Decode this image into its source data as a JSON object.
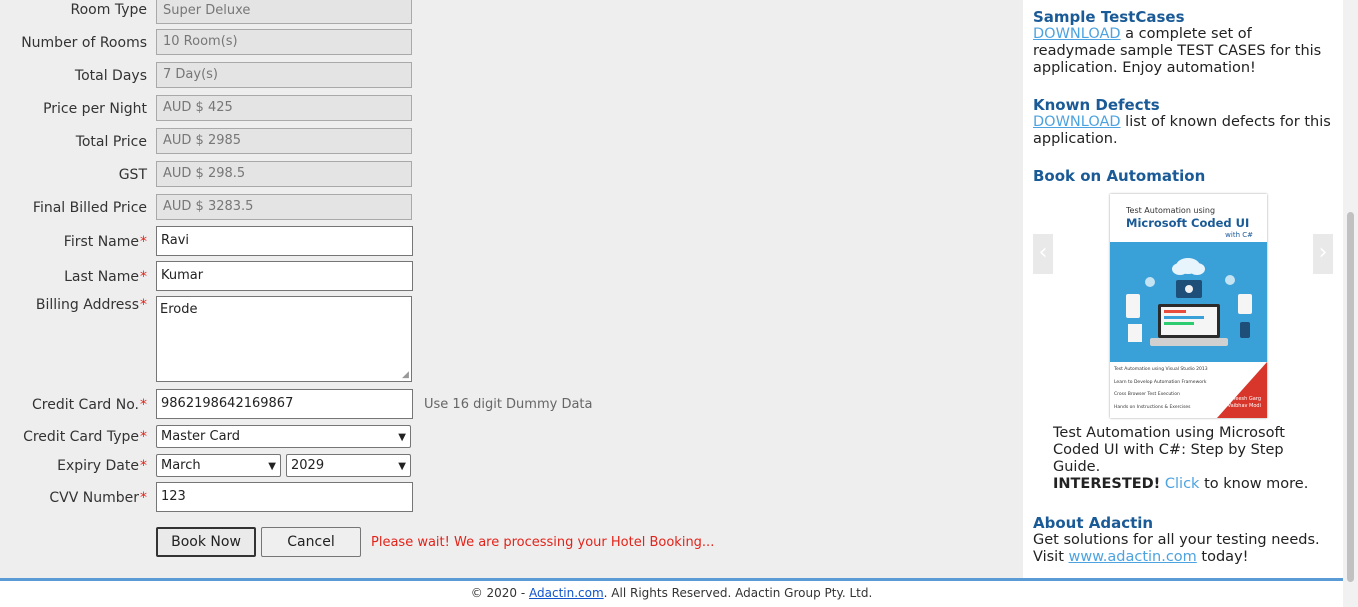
{
  "form": {
    "room_type": {
      "label": "Room Type",
      "value": "Super Deluxe"
    },
    "number_of_rooms": {
      "label": "Number of Rooms",
      "value": "10 Room(s)"
    },
    "total_days": {
      "label": "Total Days",
      "value": "7 Day(s)"
    },
    "price_per_night": {
      "label": "Price per Night",
      "value": "AUD $ 425"
    },
    "total_price": {
      "label": "Total Price",
      "value": "AUD $ 2985"
    },
    "gst": {
      "label": "GST",
      "value": "AUD $ 298.5"
    },
    "final_billed_price": {
      "label": "Final Billed Price",
      "value": "AUD $ 3283.5"
    },
    "first_name": {
      "label": "First Name",
      "value": "Ravi"
    },
    "last_name": {
      "label": "Last Name",
      "value": "Kumar"
    },
    "billing_address": {
      "label": "Billing Address",
      "value": "Erode"
    },
    "credit_card_no": {
      "label": "Credit Card No.",
      "value": "9862198642169867",
      "hint": "Use 16 digit Dummy Data"
    },
    "credit_card_type": {
      "label": "Credit Card Type",
      "value": "Master Card"
    },
    "expiry_date": {
      "label": "Expiry Date",
      "month": "March",
      "year": "2029"
    },
    "cvv_number": {
      "label": "CVV Number",
      "value": "123"
    },
    "required_mark": "*",
    "book_now_label": "Book Now",
    "cancel_label": "Cancel",
    "processing_message": "Please wait! We are processing your Hotel Booking..."
  },
  "sidebar": {
    "sample_testcases": {
      "title": "Sample TestCases",
      "link": "DOWNLOAD",
      "text": " a complete set of readymade sample TEST CASES for this application. Enjoy automation!"
    },
    "known_defects": {
      "title": "Known Defects",
      "link": "DOWNLOAD",
      "text": " list of known defects for this application."
    },
    "book_on_automation": {
      "title": "Book on Automation",
      "cover_subtitle": "Test Automation using",
      "cover_title": "Microsoft Coded UI",
      "cover_with": "with C#",
      "cover_bullets": [
        "Test Automation using Visual Studio 2013",
        "Learn to Develop Automation Framework",
        "Cross Browser Test Execution",
        "Hands on Instructions & Exercises"
      ],
      "cover_authors": [
        "Navneesh Garg",
        "Vaibhav Modi"
      ],
      "description": "Test Automation using Microsoft Coded UI with C#: Step by Step Guide.",
      "interested": "INTERESTED!",
      "click_link": "Click",
      "know_more": " to know more."
    },
    "about": {
      "title": "About Adactin",
      "text1": "Get solutions for all your testing needs.",
      "visit": "Visit ",
      "link": "www.adactin.com",
      "today": " today!"
    }
  },
  "footer": {
    "prefix": "© 2020 - ",
    "link": "Adactin.com",
    "suffix": ". All Rights Reserved. Adactin Group Pty. Ltd."
  },
  "colors": {
    "accent_blue": "#1a5a96",
    "link_blue": "#4da3e0",
    "required_red": "#e2231a",
    "footer_bar": "#5b9bd5"
  }
}
